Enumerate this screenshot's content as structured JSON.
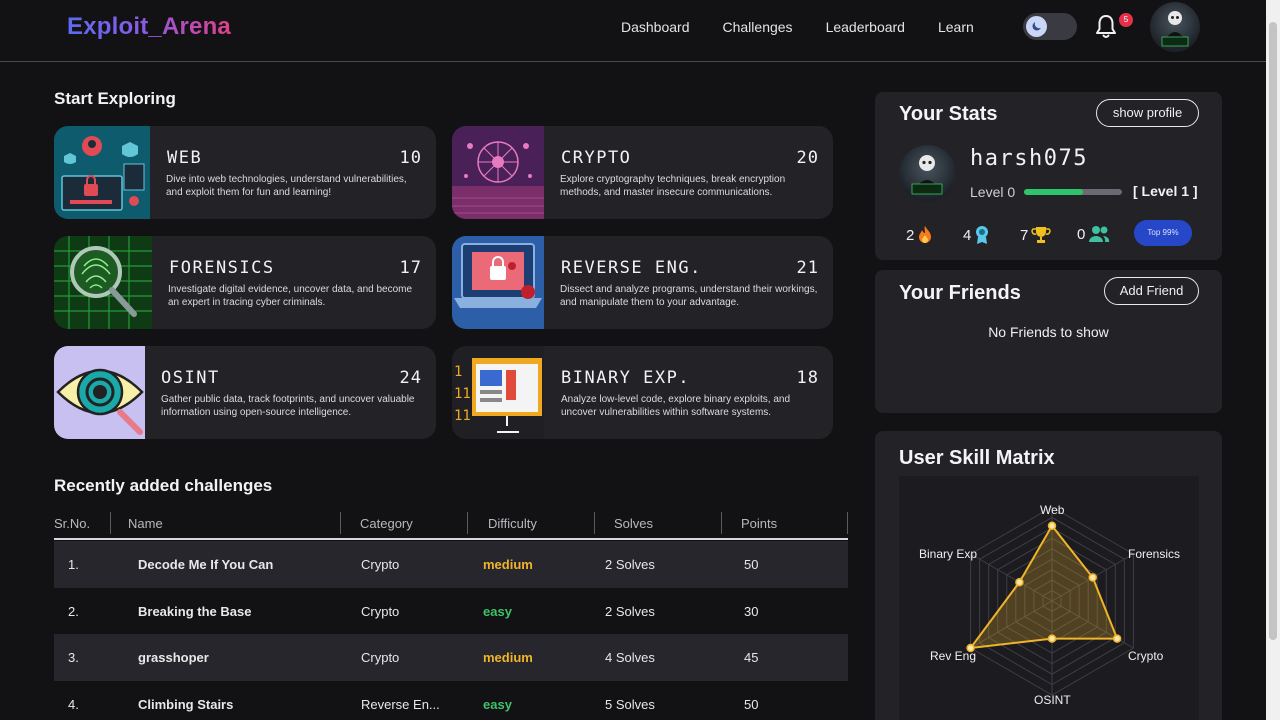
{
  "header": {
    "logo": "Exploit_Arena",
    "nav": [
      "Dashboard",
      "Challenges",
      "Leaderboard",
      "Learn"
    ],
    "notification_count": "5"
  },
  "explore": {
    "title": "Start Exploring",
    "categories": [
      {
        "name": "WEB",
        "count": "10",
        "desc1": "Dive into web technologies, understand vulnerabilities,",
        "desc2": "and exploit them for fun and learning!"
      },
      {
        "name": "CRYPTO",
        "count": "20",
        "desc1": "Explore cryptography techniques, break encryption",
        "desc2": "methods, and master insecure communications."
      },
      {
        "name": "FORENSICS",
        "count": "17",
        "desc1": "Investigate digital evidence, uncover data, and become",
        "desc2": "an expert in tracing cyber criminals."
      },
      {
        "name": "REVERSE ENG.",
        "count": "21",
        "desc1": "Dissect and analyze programs, understand their workings,",
        "desc2": "and manipulate them to your advantage."
      },
      {
        "name": "OSINT",
        "count": "24",
        "desc1": "Gather public data, track footprints, and uncover valuable",
        "desc2": "information using open-source intelligence."
      },
      {
        "name": "BINARY EXP.",
        "count": "18",
        "desc1": "Analyze low-level code, explore binary exploits, and",
        "desc2": "uncover vulnerabilities within software systems."
      }
    ]
  },
  "recent": {
    "title": "Recently added challenges",
    "columns": [
      "Sr.No.",
      "Name",
      "Category",
      "Difficulty",
      "Solves",
      "Points"
    ],
    "rows": [
      {
        "sr": "1.",
        "name": "Decode Me If You Can",
        "category": "Crypto",
        "difficulty": "medium",
        "solves": "2 Solves",
        "points": "50"
      },
      {
        "sr": "2.",
        "name": "Breaking the Base",
        "category": "Crypto",
        "difficulty": "easy",
        "solves": "2 Solves",
        "points": "30"
      },
      {
        "sr": "3.",
        "name": "grasshoper",
        "category": "Crypto",
        "difficulty": "medium",
        "solves": "4 Solves",
        "points": "45"
      },
      {
        "sr": "4.",
        "name": "Climbing Stairs",
        "category": "Reverse En...",
        "difficulty": "easy",
        "solves": "5 Solves",
        "points": "50"
      }
    ]
  },
  "stats": {
    "title": "Your Stats",
    "show_profile": "show profile",
    "username": "harsh075",
    "level_label": "Level 0",
    "level_badge": "[ Level 1 ]",
    "level_progress": 0.6,
    "streak": "2",
    "badges": "4",
    "trophies": "7",
    "friends": "0",
    "top_badge": "Top 99%",
    "avatar_caption": "harsh075"
  },
  "friends": {
    "title": "Your Friends",
    "add_friend": "Add Friend",
    "empty": "No Friends to show"
  },
  "skill": {
    "title": "User Skill Matrix",
    "axes": [
      "Web",
      "Forensics",
      "Crypto",
      "OSINT",
      "Rev Eng",
      "Binary Exp"
    ],
    "values": [
      0.8,
      0.5,
      0.8,
      0.4,
      1.0,
      0.4
    ]
  },
  "colors": {
    "medium": "#f0b429",
    "easy": "#3ec16a",
    "radar": "#f0b429"
  }
}
